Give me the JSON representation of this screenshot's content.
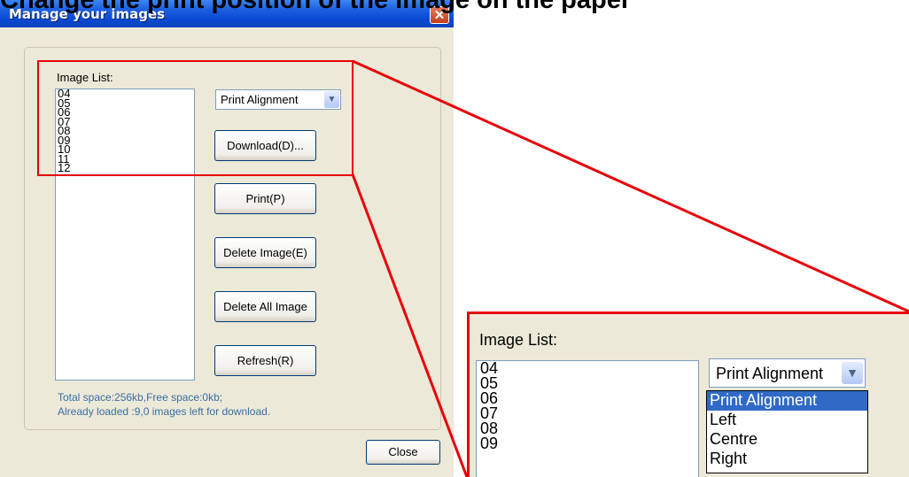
{
  "heading": "Change the print position of the image on the paper",
  "dialog": {
    "title": "Manage your images",
    "close_glyph": "✕",
    "image_list_label": "Image List:",
    "images": [
      "04",
      "05",
      "06",
      "07",
      "08",
      "09",
      "10",
      "11",
      "12"
    ],
    "combo_value": "Print Alignment",
    "buttons": {
      "download": "Download(D)...",
      "print": "Print(P)",
      "delete_image": "Delete Image(E)",
      "delete_all": "Delete All Image",
      "refresh": "Refresh(R)"
    },
    "status_line1": "Total space:256kb,Free space:0kb;",
    "status_line2": "Already loaded :9,0 images left for download.",
    "close_label": "Close"
  },
  "zoom": {
    "image_list_label": "Image List:",
    "images": [
      "04",
      "05",
      "06",
      "07",
      "08",
      "09"
    ],
    "combo_value": "Print Alignment",
    "options": [
      "Print Alignment",
      "Left",
      "Centre",
      "Right"
    ],
    "selected_option": "Print Alignment"
  },
  "icons": {
    "dropdown": "chevron-down-icon",
    "close": "close-icon"
  },
  "colors": {
    "highlight": "#e8000b",
    "title_bar": "#0a49d4",
    "status_text": "#3a6ea5",
    "selection": "#316ac5"
  }
}
